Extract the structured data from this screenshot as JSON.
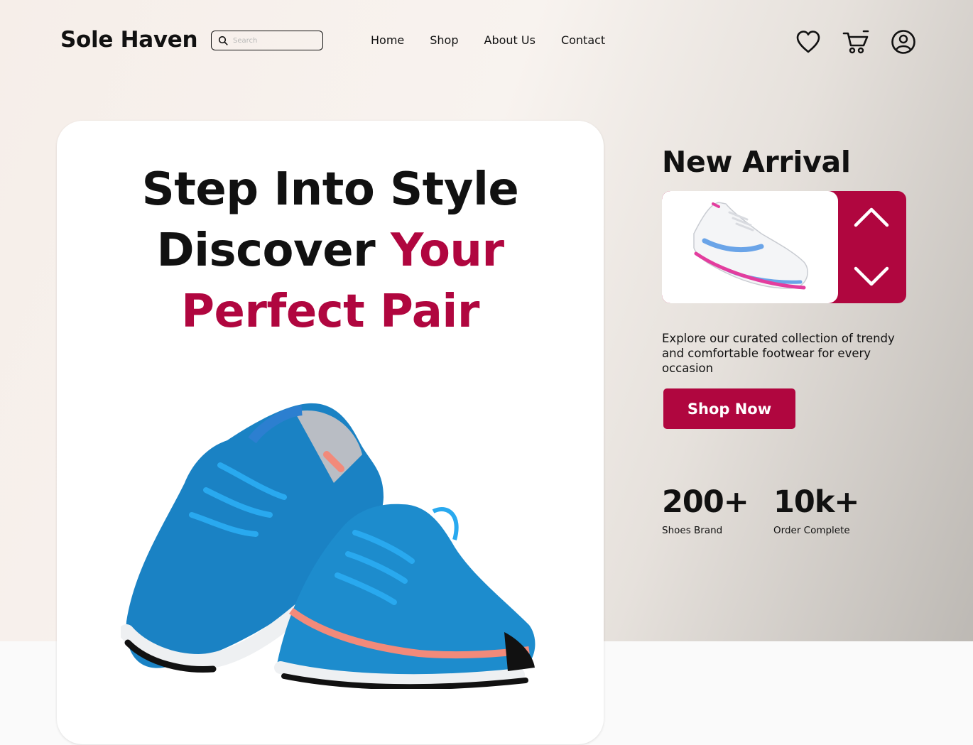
{
  "header": {
    "brand": "Sole Haven",
    "search_placeholder": "Search",
    "nav": [
      "Home",
      "Shop",
      "About Us",
      "Contact"
    ],
    "icons": [
      "heart-icon",
      "cart-icon",
      "user-icon"
    ]
  },
  "hero": {
    "line1": "Step Into Style",
    "line2_dark": "Discover",
    "line2_accent": "Your",
    "line3_accent": "Perfect Pair",
    "image_alt": "blue running shoes"
  },
  "new_arrival": {
    "title": "New Arrival",
    "image_alt": "white sneaker with blue and pink accents",
    "up_icon": "chevron-up-icon",
    "down_icon": "chevron-down-icon"
  },
  "description": "Explore our curated collection of trendy and comfortable footwear for every occasion",
  "cta": {
    "label": "Shop Now"
  },
  "stats": [
    {
      "value": "200+",
      "label": "Shoes Brand"
    },
    {
      "value": "10k+",
      "label": "Order Complete"
    }
  ],
  "colors": {
    "accent": "#b0063f",
    "text": "#111111"
  }
}
